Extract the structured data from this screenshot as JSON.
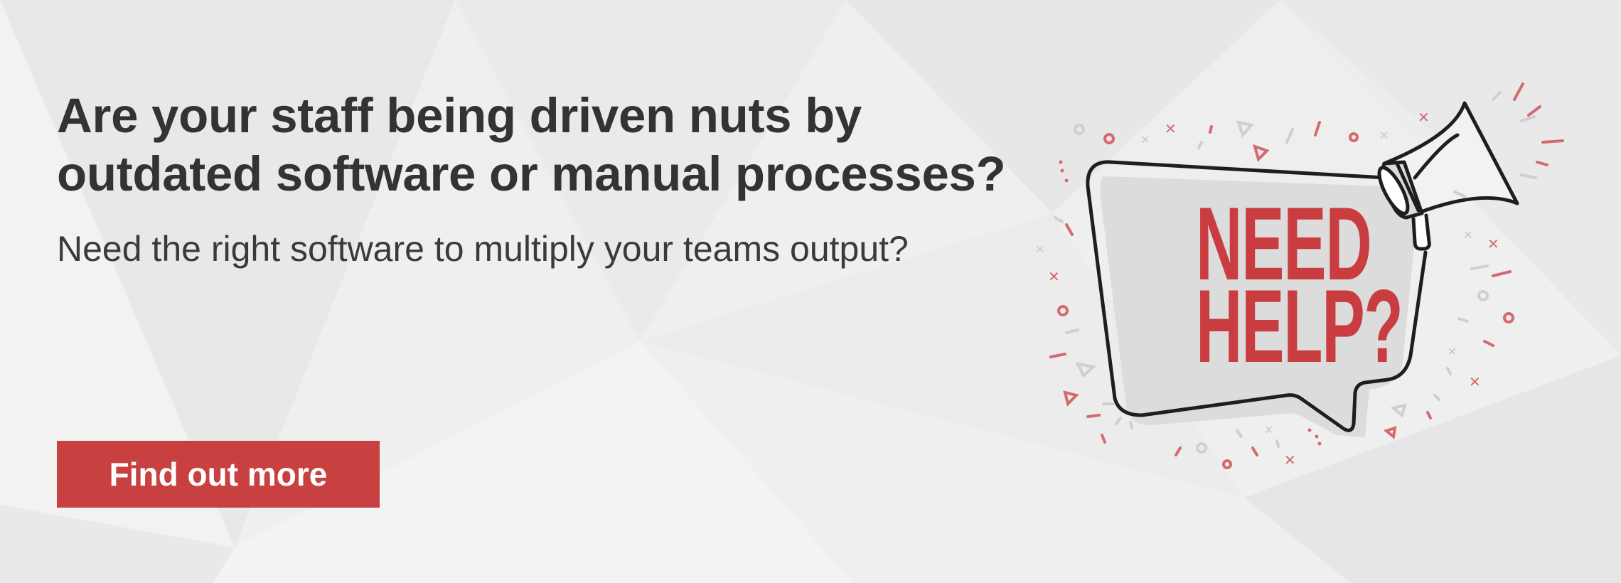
{
  "banner": {
    "headline_line1": "Are your staff being driven nuts by",
    "headline_line2": "outdated software or manual processes?",
    "subtitle": "Need the right software to multiply your teams output?",
    "cta_label": "Find out more"
  },
  "illustration": {
    "bubble_line1": "NEED",
    "bubble_line2": "HELP?",
    "icon": "megaphone-icon"
  },
  "colors": {
    "background": "#efefef",
    "text": "#333333",
    "accent": "#c84040",
    "bubble_fill": "#dcdcdc",
    "outline": "#1e1e1e"
  }
}
